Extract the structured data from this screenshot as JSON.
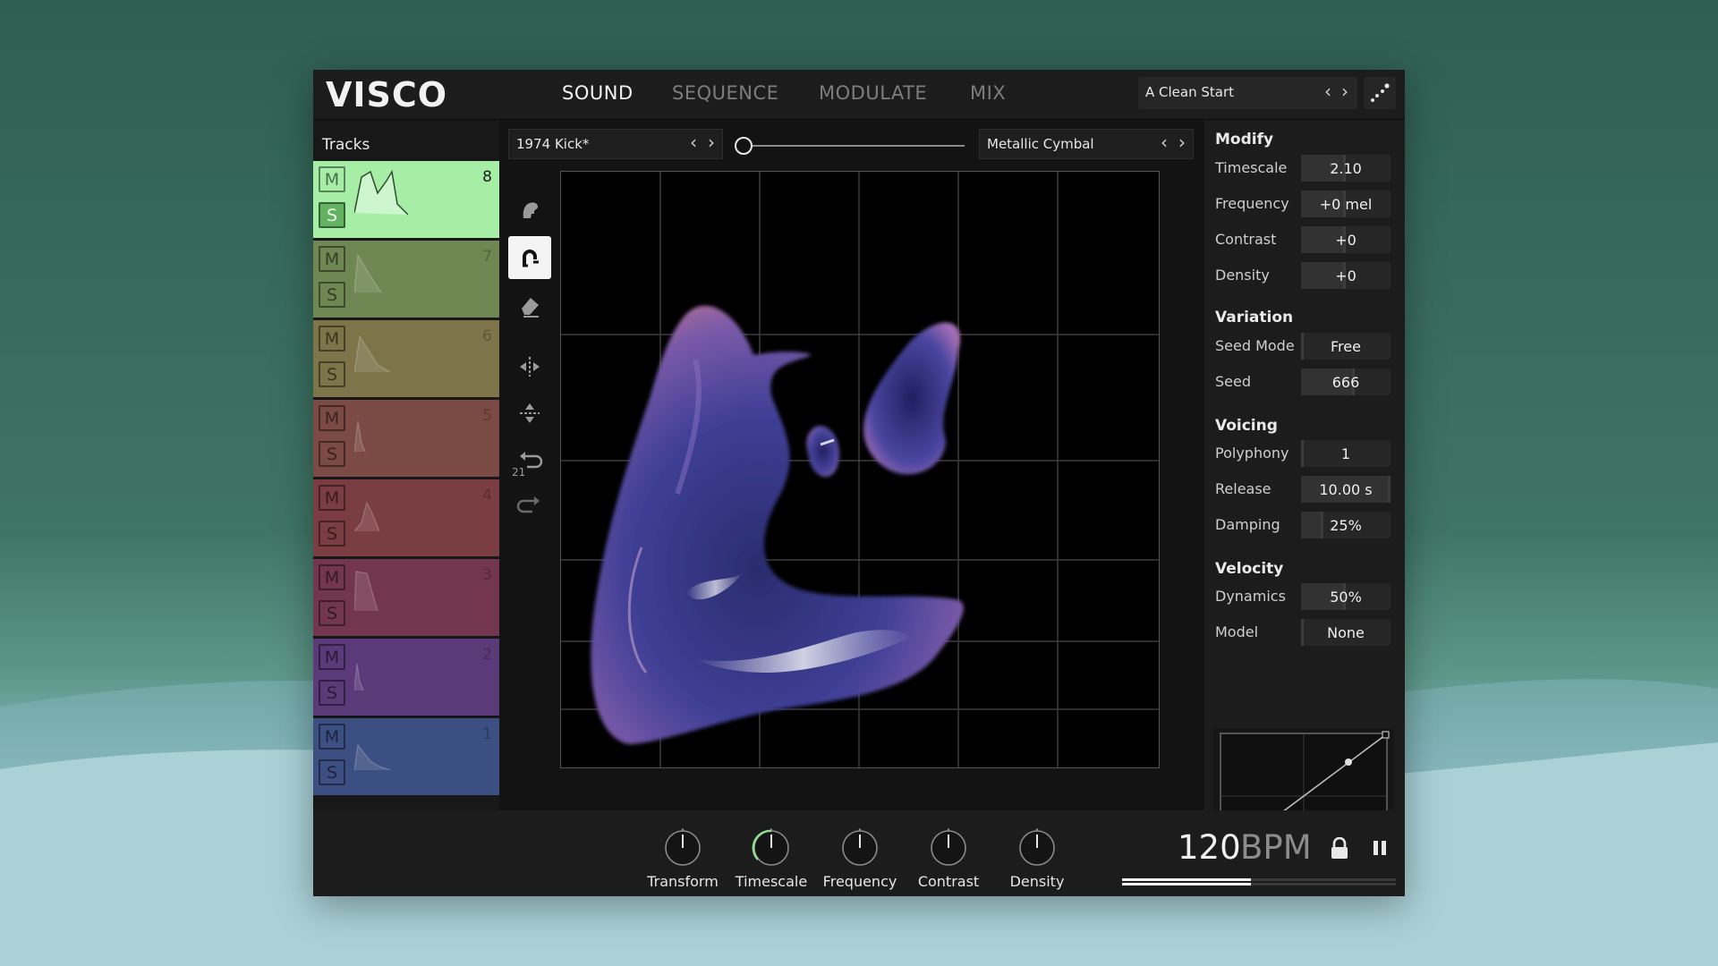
{
  "app": {
    "logo": "VISCO"
  },
  "nav": {
    "tabs": [
      {
        "label": "SOUND",
        "active": true
      },
      {
        "label": "SEQUENCE",
        "active": false
      },
      {
        "label": "MODULATE",
        "active": false
      },
      {
        "label": "MIX",
        "active": false
      }
    ]
  },
  "preset": {
    "name": "A Clean Start",
    "prev": "‹",
    "next": "›"
  },
  "tracks": {
    "title": "Tracks",
    "mute_label": "M",
    "solo_label": "S",
    "items": [
      {
        "number": "8",
        "color": "#a6eea6",
        "selected": true
      },
      {
        "number": "7",
        "color": "#6f8752"
      },
      {
        "number": "6",
        "color": "#7d7449"
      },
      {
        "number": "5",
        "color": "#7b4a45"
      },
      {
        "number": "4",
        "color": "#7a3d42"
      },
      {
        "number": "3",
        "color": "#73364f"
      },
      {
        "number": "2",
        "color": "#5a3a78"
      },
      {
        "number": "1",
        "color": "#3c4f82"
      }
    ]
  },
  "tools": {
    "undo_count": "21"
  },
  "sound": {
    "left_sample": "1974 Kick*",
    "right_sample": "Metallic Cymbal",
    "morph_position": 0.0
  },
  "modify": {
    "title": "Modify",
    "params": [
      {
        "label": "Timescale",
        "value": "2.10",
        "level": 0.5
      },
      {
        "label": "Frequency",
        "value": "+0 mel",
        "level": 0.5
      },
      {
        "label": "Contrast",
        "value": "+0",
        "level": 0.5
      },
      {
        "label": "Density",
        "value": "+0",
        "level": 0.5
      }
    ]
  },
  "variation": {
    "title": "Variation",
    "params": [
      {
        "label": "Seed Mode",
        "value": "Free",
        "level": 0.0
      },
      {
        "label": "Seed",
        "value": "666",
        "level": 0.6
      }
    ]
  },
  "voicing": {
    "title": "Voicing",
    "params": [
      {
        "label": "Polyphony",
        "value": "1",
        "level": 0.0
      },
      {
        "label": "Release",
        "value": "10.00 s",
        "level": 1.0
      },
      {
        "label": "Damping",
        "value": "25%",
        "level": 0.25
      }
    ]
  },
  "velocity": {
    "title": "Velocity",
    "params": [
      {
        "label": "Dynamics",
        "value": "50%",
        "level": 0.5
      },
      {
        "label": "Model",
        "value": "None",
        "level": 0.0
      }
    ]
  },
  "knobs": [
    {
      "label": "Transform",
      "value": 0.5,
      "active": false
    },
    {
      "label": "Timescale",
      "value": 0.5,
      "active": true
    },
    {
      "label": "Frequency",
      "value": 0.5,
      "active": false
    },
    {
      "label": "Contrast",
      "value": 0.5,
      "active": false
    },
    {
      "label": "Density",
      "value": 0.5,
      "active": false
    }
  ],
  "transport": {
    "bpm": "120",
    "bpm_unit": "BPM",
    "playback_progress": 0.47
  },
  "colors": {
    "accent": "#a6eea6",
    "panel": "#1c1c1c",
    "canvas": "#000000"
  }
}
